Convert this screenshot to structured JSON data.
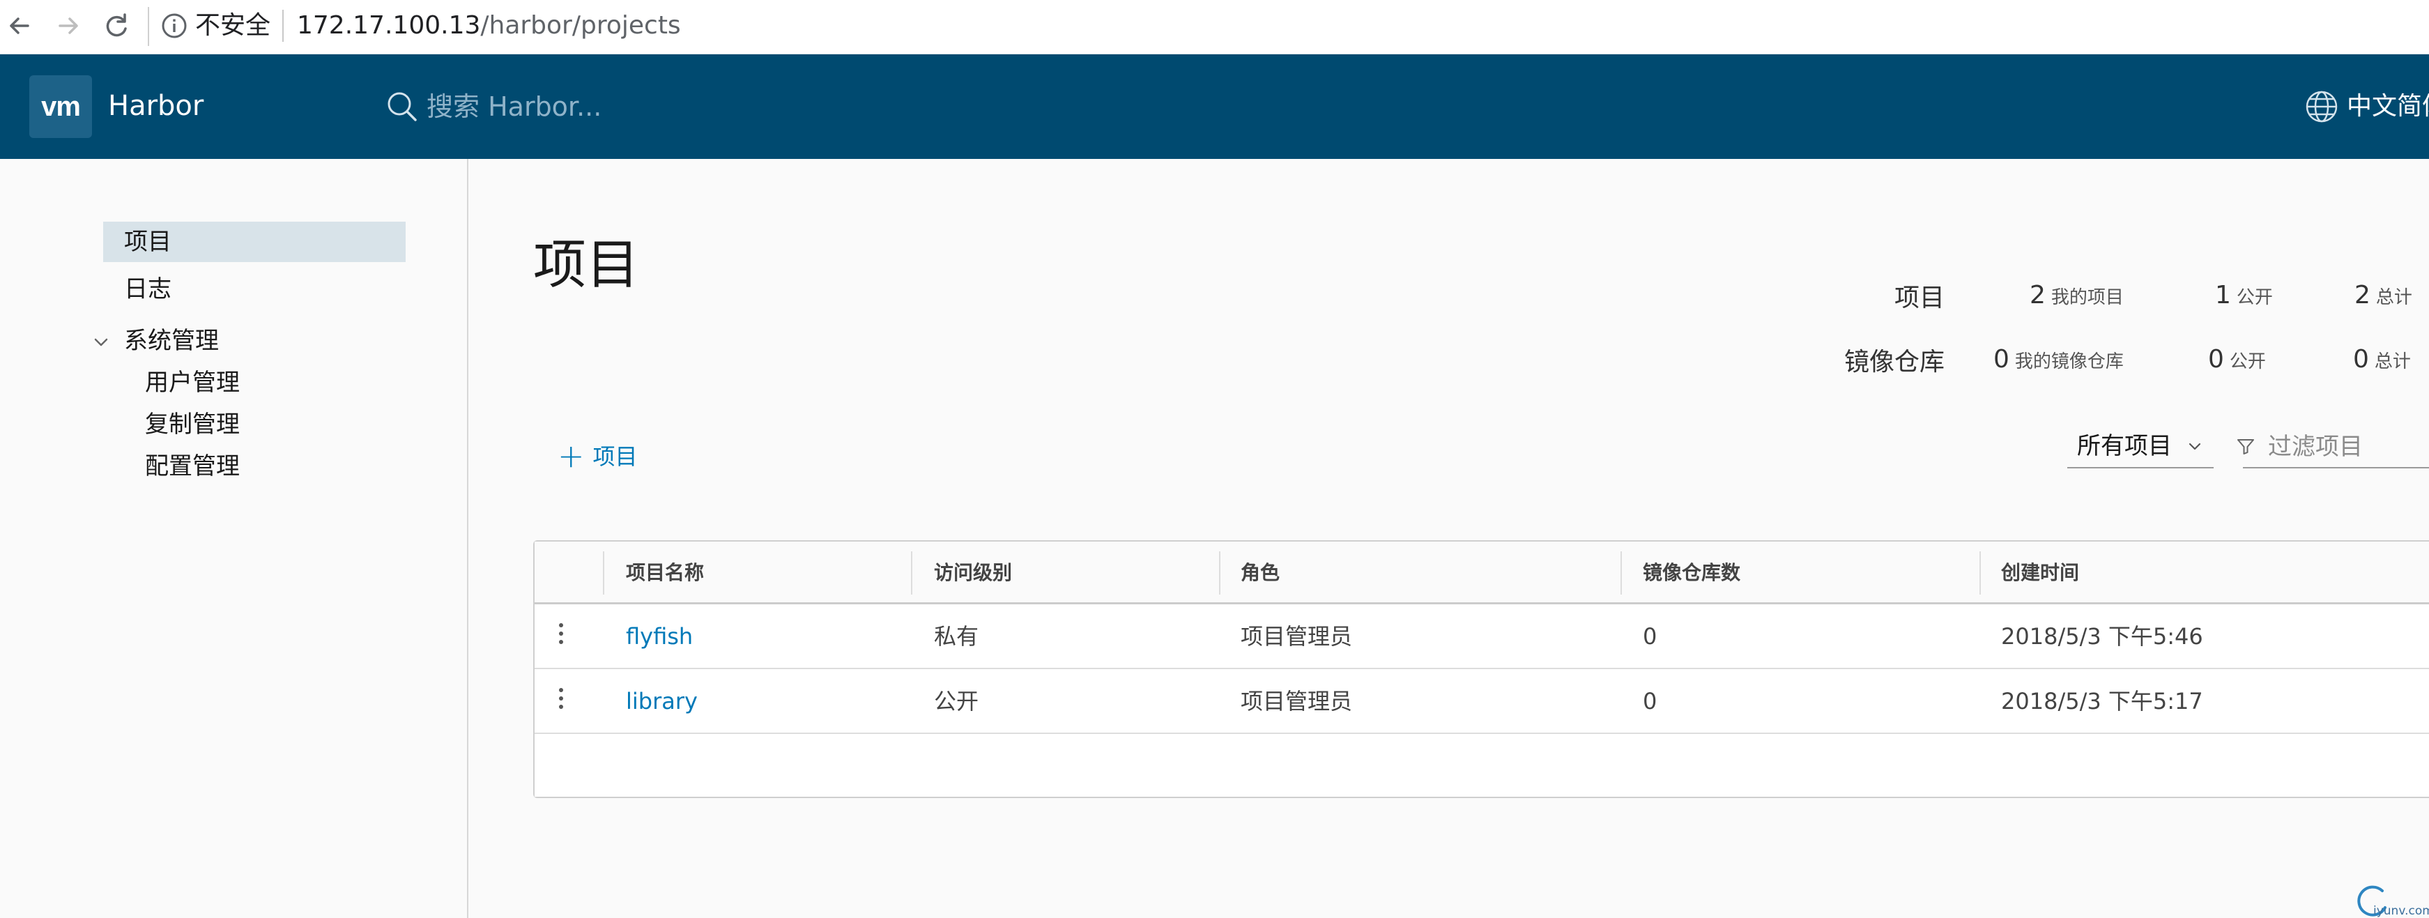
{
  "browser": {
    "security_label": "不安全",
    "url_host": "172.17.100.13",
    "url_path": "/harbor/projects"
  },
  "header": {
    "logo_text": "vm",
    "brand": "Harbor",
    "search_placeholder": "搜索 Harbor...",
    "language": "中文简体"
  },
  "sidebar": {
    "items": [
      {
        "label": "项目"
      },
      {
        "label": "日志"
      },
      {
        "label": "系统管理"
      }
    ],
    "admin_children": [
      {
        "label": "用户管理"
      },
      {
        "label": "复制管理"
      },
      {
        "label": "配置管理"
      }
    ]
  },
  "main": {
    "title": "项目",
    "summary": {
      "projects_label": "项目",
      "projects_mine": {
        "value": "2",
        "caption": "我的项目"
      },
      "projects_public": {
        "value": "1",
        "caption": "公开"
      },
      "projects_total": {
        "value": "2",
        "caption": "总计"
      },
      "repos_label": "镜像仓库",
      "repos_mine": {
        "value": "0",
        "caption": "我的镜像仓库"
      },
      "repos_public": {
        "value": "0",
        "caption": "公开"
      },
      "repos_total": {
        "value": "0",
        "caption": "总计"
      }
    },
    "new_project_label": "项目",
    "filter_select": "所有项目",
    "filter_placeholder": "过滤项目",
    "table": {
      "columns": [
        "项目名称",
        "访问级别",
        "角色",
        "镜像仓库数",
        "创建时间"
      ],
      "rows": [
        {
          "name": "flyfish",
          "access": "私有",
          "role": "项目管理员",
          "repos": "0",
          "created": "2018/5/3 下午5:46"
        },
        {
          "name": "library",
          "access": "公开",
          "role": "项目管理员",
          "repos": "0",
          "created": "2018/5/3 下午5:17"
        }
      ]
    }
  },
  "watermark": {
    "text": "iyunv.com"
  }
}
